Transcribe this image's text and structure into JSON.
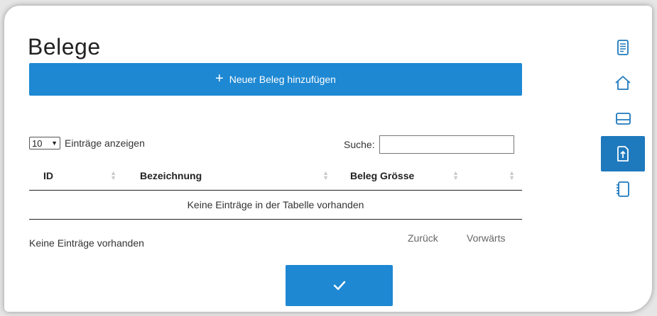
{
  "page": {
    "title": "Belege"
  },
  "actions": {
    "add_label": "Neuer Beleg hinzufügen",
    "add_icon": "plus-icon",
    "confirm_icon": "check-icon"
  },
  "table": {
    "length_value": "10",
    "length_label": "Einträge anzeigen",
    "search_label": "Suche:",
    "search_value": "",
    "columns": [
      "ID",
      "Bezeichnung",
      "Beleg Grösse",
      ""
    ],
    "empty_message": "Keine Einträge in der Tabelle vorhanden",
    "info": "Keine Einträge vorhanden",
    "prev_label": "Zurück",
    "next_label": "Vorwärts"
  },
  "sidebar": {
    "items": [
      {
        "icon": "document-icon",
        "active": false
      },
      {
        "icon": "home-icon",
        "active": false
      },
      {
        "icon": "card-icon",
        "active": false
      },
      {
        "icon": "upload-document-icon",
        "active": true
      },
      {
        "icon": "notebook-icon",
        "active": false
      }
    ]
  },
  "colors": {
    "accent": "#1e88d3",
    "sidebar_active": "#1e79bd"
  }
}
